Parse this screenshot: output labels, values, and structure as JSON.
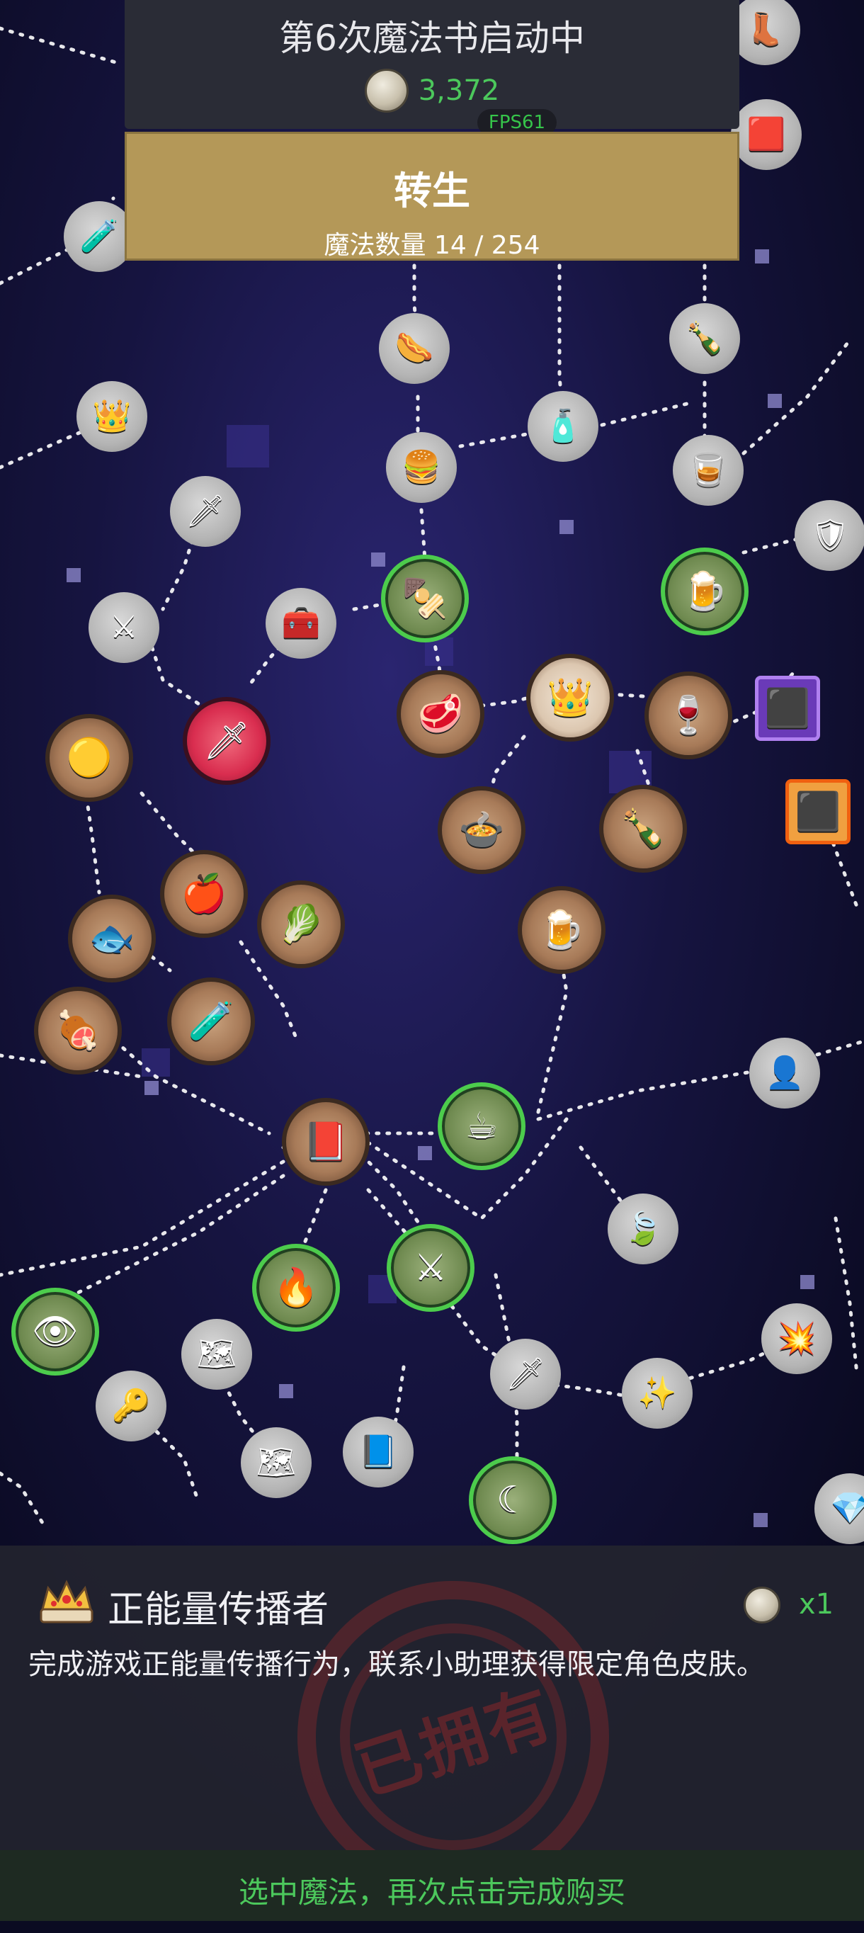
{
  "header": {
    "title": "第6次魔法书启动中",
    "coins": "3,372",
    "fps": "FPS61"
  },
  "rebirth": {
    "label": "转生",
    "magic_count": "魔法数量 14 / 254"
  },
  "selected": {
    "title": "正能量传播者",
    "description": "完成游戏正能量传播行为，联系小助理获得限定角色皮肤。",
    "quantity": "x1",
    "stamp": "已拥有"
  },
  "bottom_hint": "选中魔法，再次点击完成购买",
  "colors": {
    "accent_green": "#4cc85c",
    "panel": "#2a2c36",
    "rebirth_gold": "#b49858",
    "stamp_red": "#a02828"
  },
  "nodes": [
    {
      "icon": "boot-icon",
      "style": "gray",
      "glyph": "👢"
    },
    {
      "icon": "card-icon",
      "style": "gray",
      "glyph": "🟥"
    },
    {
      "icon": "potion-icon",
      "style": "gray",
      "glyph": "🧪"
    },
    {
      "icon": "treasure-icon",
      "style": "gray",
      "glyph": "👑"
    },
    {
      "icon": "hotdog-icon",
      "style": "gray",
      "glyph": "🌭"
    },
    {
      "icon": "blue-potion-icon",
      "style": "gray",
      "glyph": "🧴"
    },
    {
      "icon": "wine-bottle-icon",
      "style": "gray",
      "glyph": "🍾"
    },
    {
      "icon": "burger-icon",
      "style": "gray",
      "glyph": "🍔"
    },
    {
      "icon": "whiskey-icon",
      "style": "gray",
      "glyph": "🥃"
    },
    {
      "icon": "sword-icon",
      "style": "gray",
      "glyph": "🗡"
    },
    {
      "icon": "sword-icon",
      "style": "gray",
      "glyph": "⚔"
    },
    {
      "icon": "chest-icon",
      "style": "gray",
      "glyph": "🧰"
    },
    {
      "icon": "kebab-icon",
      "style": "green",
      "glyph": "🍢"
    },
    {
      "icon": "beer-icon",
      "style": "green",
      "glyph": "🍺"
    },
    {
      "icon": "knight-icon",
      "style": "gray",
      "glyph": "🛡"
    },
    {
      "icon": "red-sword-icon",
      "style": "red",
      "glyph": "🗡"
    },
    {
      "icon": "steak-icon",
      "style": "bronze",
      "glyph": "🥩"
    },
    {
      "icon": "crown-icon",
      "style": "crown",
      "glyph": "👑"
    },
    {
      "icon": "wine-icon",
      "style": "bronze",
      "glyph": "🍷"
    },
    {
      "icon": "coal-purple-icon",
      "style": "square-purple",
      "glyph": "⬛"
    },
    {
      "icon": "coal-orange-icon",
      "style": "square-orange",
      "glyph": "⬛"
    },
    {
      "icon": "slime-icon",
      "style": "bronze",
      "glyph": "🟡"
    },
    {
      "icon": "soup-icon",
      "style": "bronze",
      "glyph": "🍲"
    },
    {
      "icon": "bottle-icon",
      "style": "bronze",
      "glyph": "🍾"
    },
    {
      "icon": "apple-icon",
      "style": "bronze",
      "glyph": "🍎"
    },
    {
      "icon": "cabbage-icon",
      "style": "bronze",
      "glyph": "🥬"
    },
    {
      "icon": "mug-icon",
      "style": "bronze",
      "glyph": "🍺"
    },
    {
      "icon": "fish-icon",
      "style": "bronze",
      "glyph": "🐟"
    },
    {
      "icon": "meat-icon",
      "style": "bronze",
      "glyph": "🍖"
    },
    {
      "icon": "blue-flask-icon",
      "style": "bronze",
      "glyph": "🧪"
    },
    {
      "icon": "scarecrow-icon",
      "style": "gray",
      "glyph": "👤"
    },
    {
      "icon": "book-icon",
      "style": "bronze",
      "glyph": "📕"
    },
    {
      "icon": "coffee-icon",
      "style": "green",
      "glyph": "☕"
    },
    {
      "icon": "leaf-icon",
      "style": "gray",
      "glyph": "🍃"
    },
    {
      "icon": "torch-icon",
      "style": "green",
      "glyph": "🔥"
    },
    {
      "icon": "crossed-swords-icon",
      "style": "green",
      "glyph": "⚔"
    },
    {
      "icon": "eye-icon",
      "style": "green",
      "glyph": "👁"
    },
    {
      "icon": "explosion-icon",
      "style": "gray",
      "glyph": "💥"
    },
    {
      "icon": "map-icon",
      "style": "gray",
      "glyph": "🗺"
    },
    {
      "icon": "key-icon",
      "style": "gray",
      "glyph": "🔑"
    },
    {
      "icon": "fire-sword-icon",
      "style": "gray",
      "glyph": "🗡"
    },
    {
      "icon": "spark-sword-icon",
      "style": "gray",
      "glyph": "✨"
    },
    {
      "icon": "scroll-map-icon",
      "style": "gray",
      "glyph": "🗺"
    },
    {
      "icon": "spellbook-icon",
      "style": "gray",
      "glyph": "📘"
    },
    {
      "icon": "moon-icon",
      "style": "green",
      "glyph": "☾"
    },
    {
      "icon": "gem-icon",
      "style": "gray",
      "glyph": "💎"
    }
  ]
}
